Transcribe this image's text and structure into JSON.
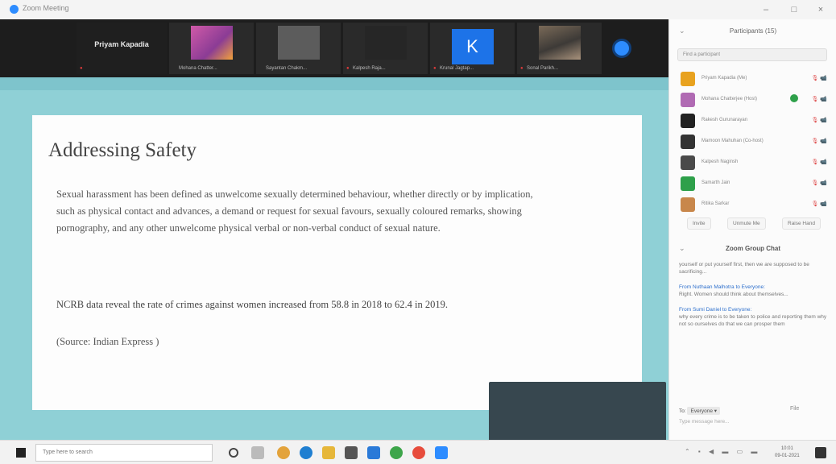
{
  "window": {
    "app_title": "Zoom Meeting",
    "min_label": "–",
    "max_label": "□",
    "close_label": "×"
  },
  "strip": {
    "presenter_name": "Priyam Kapadia",
    "tiles": [
      {
        "label": "Mohana Chatter..."
      },
      {
        "label": "Sayantan Chakm..."
      },
      {
        "label": "Kalpesh Raja..."
      },
      {
        "label": "Krunal Jagtap..."
      },
      {
        "label": "Sonal Parikh..."
      }
    ],
    "k_initial": "K"
  },
  "slide": {
    "title": "Addressing Safety",
    "paragraph": "Sexual harassment has been defined  as unwelcome sexually determined behaviour, whether directly or by implication, such as physical contact and advances, a demand or request for sexual favours, sexually coloured remarks, showing pornography, and any other unwelcome physical verbal or non-verbal conduct of sexual nature.",
    "stat": "NCRB data reveal the rate of crimes against women increased from 58.8 in 2018 to 62.4 in 2019.",
    "source": "(Source: Indian Express )"
  },
  "panel": {
    "header": "Participants (15)",
    "collapse_icon": "⌄",
    "find_placeholder": "Find a participant",
    "participants": [
      {
        "name": "Priyam Kapadia (Me)",
        "color": "#e8a21f",
        "status": "🎙 📹"
      },
      {
        "name": "Mohana Chatterjee (Host)",
        "color": "#b06ab3",
        "status": "🎙 📹"
      },
      {
        "name": "Rakesh Gurunarayan",
        "color": "#222222",
        "status": "🎙 📹"
      },
      {
        "name": "Mamoon Mahuhan (Co-host)",
        "color": "#333333",
        "status": "🎙 📹"
      },
      {
        "name": "Kalpesh Naginsh",
        "color": "#4a4a4a",
        "status": "🎙 📹"
      },
      {
        "name": "Samarth Jain",
        "color": "#2ea04a",
        "status": "🎙 📹"
      },
      {
        "name": "Ritika Sarkar",
        "color": "#c8874b",
        "status": "🎙 📹"
      }
    ],
    "buttons": [
      "Invite",
      "Unmute Me",
      "Raise Hand"
    ],
    "chat_header": "Zoom Group Chat",
    "messages": [
      {
        "from": "",
        "text": "yourself or put yourself first, then we are supposed to be sacrificing..."
      },
      {
        "from": "From Nuthaan Malhotra to Everyone:",
        "text": "Right. Women should think about themselves..."
      },
      {
        "from": "From Sumi Daniel to Everyone:",
        "text": "why every crime is to be taken to police and reporting them why not so ourselves do that we can prosper them"
      }
    ],
    "chat_to_label": "To:",
    "chat_to_value": "Everyone ▾",
    "chat_file_label": "File",
    "chat_input_placeholder": "Type message here..."
  },
  "taskbar": {
    "search_placeholder": "Type here to search",
    "time": "10:01",
    "date": "09-01-2021"
  }
}
